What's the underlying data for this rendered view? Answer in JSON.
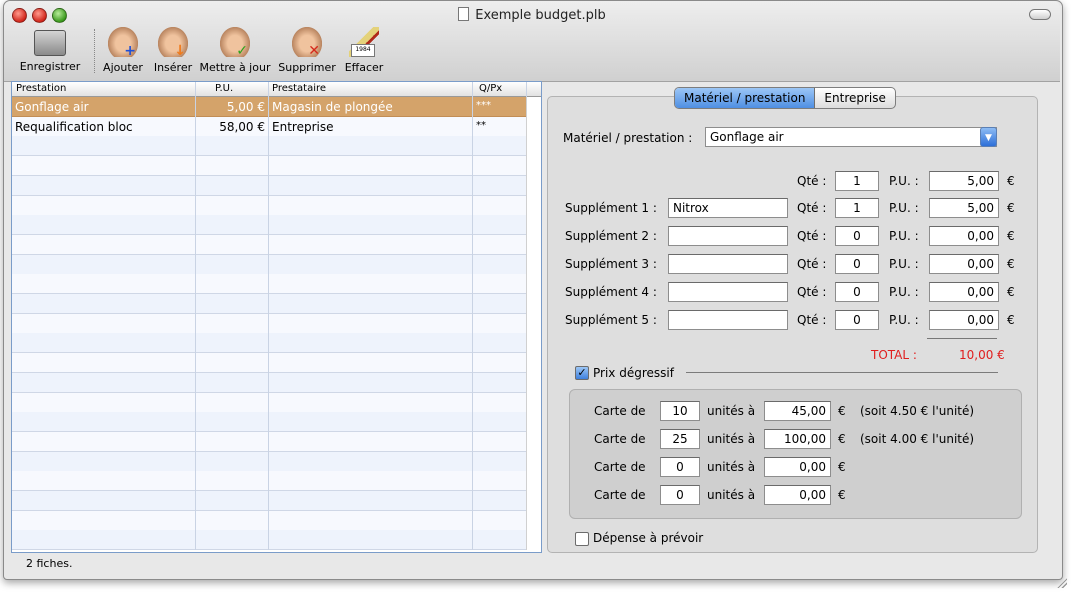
{
  "window": {
    "title": "Exemple budget.plb"
  },
  "toolbar": {
    "save": "Enregistrer",
    "add": "Ajouter",
    "insert": "Insérer",
    "update": "Mettre à jour",
    "delete": "Supprimer",
    "clear": "Effacer",
    "clear_icon_text": "1984"
  },
  "table": {
    "headers": {
      "prestation": "Prestation",
      "pu": "P.U.",
      "prestataire": "Prestataire",
      "qpx": "Q/Px"
    },
    "rows": [
      {
        "prestation": "Gonflage air",
        "pu": "5,00 €",
        "prestataire": "Magasin de plongée",
        "qpx": "***",
        "selected": true
      },
      {
        "prestation": "Requalification bloc",
        "pu": "58,00 €",
        "prestataire": "Entreprise",
        "qpx": "**",
        "selected": false
      }
    ]
  },
  "status": "2 fiches.",
  "tabs": {
    "active": "Matériel / prestation",
    "other": "Entreprise"
  },
  "form": {
    "materiel_label": "Matériel / prestation :",
    "materiel_value": "Gonflage air",
    "qte_label": "Qté :",
    "pu_label": "P.U. :",
    "euro": "€",
    "main": {
      "qte": "1",
      "pu": "5,00"
    },
    "supplements": [
      {
        "label": "Supplément 1 :",
        "name": "Nitrox",
        "qte": "1",
        "pu": "5,00"
      },
      {
        "label": "Supplément 2 :",
        "name": "",
        "qte": "0",
        "pu": "0,00"
      },
      {
        "label": "Supplément 3 :",
        "name": "",
        "qte": "0",
        "pu": "0,00"
      },
      {
        "label": "Supplément 4 :",
        "name": "",
        "qte": "0",
        "pu": "0,00"
      },
      {
        "label": "Supplément 5 :",
        "name": "",
        "qte": "0",
        "pu": "0,00"
      }
    ],
    "total_label": "TOTAL :",
    "total_value": "10,00  €",
    "prix_degressif_label": "Prix dégressif",
    "prix_degressif_checked": true,
    "cartes": {
      "carte_label": "Carte de",
      "unites_label": "unités à",
      "rows": [
        {
          "units": "10",
          "price": "45,00",
          "note": "(soit 4.50 € l'unité)"
        },
        {
          "units": "25",
          "price": "100,00",
          "note": "(soit 4.00 € l'unité)"
        },
        {
          "units": "0",
          "price": "0,00",
          "note": ""
        },
        {
          "units": "0",
          "price": "0,00",
          "note": ""
        }
      ]
    },
    "depense_label": "Dépense à prévoir",
    "depense_checked": false
  },
  "colors": {
    "selection": "#d4a36a",
    "total": "#e01d1d",
    "accent": "#4f8fe3"
  }
}
